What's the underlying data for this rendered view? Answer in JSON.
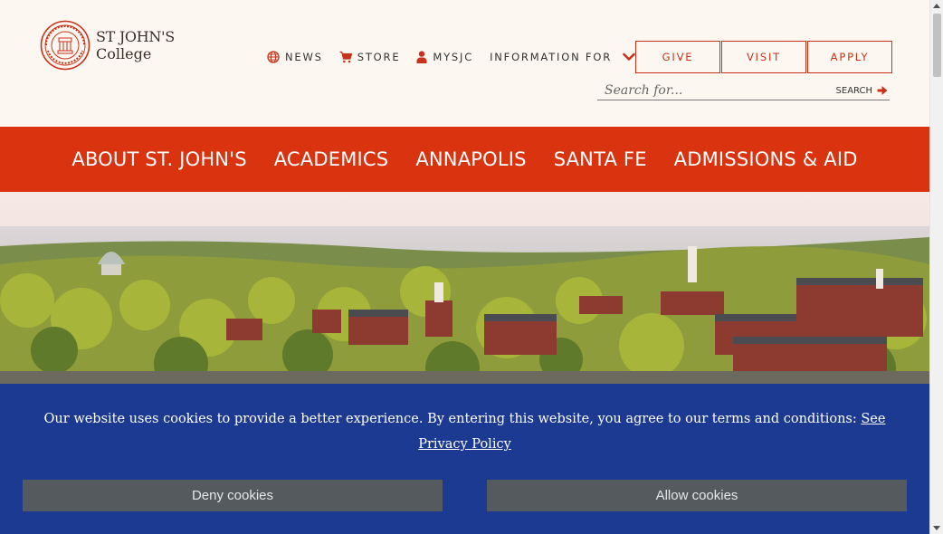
{
  "brand": {
    "line1": "ST JOHN'S",
    "line2": "College",
    "seal_icon": "college-seal",
    "color": "#c9321a"
  },
  "utility_nav": {
    "items": [
      {
        "label": "NEWS",
        "icon": "globe-icon"
      },
      {
        "label": "STORE",
        "icon": "cart-icon"
      },
      {
        "label": "MYSJC",
        "icon": "user-icon"
      },
      {
        "label": "INFORMATION FOR",
        "icon": "chevron-down-icon"
      }
    ]
  },
  "cta_buttons": {
    "give": "GIVE",
    "visit": "VISIT",
    "apply": "APPLY"
  },
  "search": {
    "placeholder": "Search for...",
    "button_label": "SEARCH",
    "button_icon": "arrow-right-icon"
  },
  "main_nav": {
    "items": [
      "ABOUT ST. JOHN'S",
      "ACADEMICS",
      "ANNAPOLIS",
      "SANTA FE",
      "ADMISSIONS & AID"
    ],
    "background": "#d9330f"
  },
  "hero": {
    "image": "aerial view of Annapolis campus"
  },
  "cookie_banner": {
    "text": "Our website uses cookies to provide a better experience. By entering this website, you agree to our terms and conditions: ",
    "link_text": "See Privacy Policy",
    "deny_label": "Deny cookies",
    "allow_label": "Allow cookies",
    "background": "#1c3a91",
    "button_color": "#545a5e"
  }
}
